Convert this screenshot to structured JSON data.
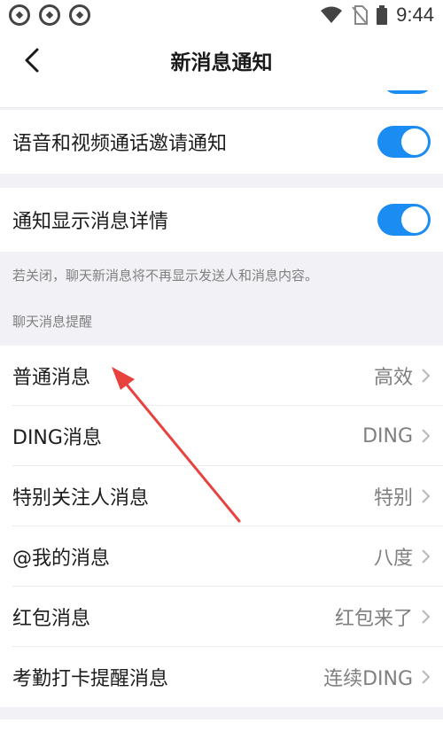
{
  "status_bar": {
    "time": "9:44",
    "left_icons": [
      "app-icon",
      "app-icon",
      "app-icon"
    ],
    "right_icons": [
      "wifi-icon",
      "no-sim-icon",
      "battery-icon"
    ]
  },
  "nav": {
    "title": "新消息通知",
    "back_icon": "chevron-left-icon"
  },
  "settings": {
    "voice_video_invite": {
      "label": "语音和视频通话邀请通知",
      "enabled": true
    },
    "show_details": {
      "label": "通知显示消息详情",
      "enabled": true
    },
    "show_details_hint": "若关闭，聊天新消息将不再显示发送人和消息内容。"
  },
  "section_header": "聊天消息提醒",
  "reminder_items": [
    {
      "label": "普通消息",
      "value": "高效"
    },
    {
      "label": "DING消息",
      "value": "DING"
    },
    {
      "label": "特别关注人消息",
      "value": "特别"
    },
    {
      "label": "@我的消息",
      "value": "八度"
    },
    {
      "label": "红包消息",
      "value": "红包来了"
    },
    {
      "label": "考勤打卡提醒消息",
      "value": "连续DING"
    }
  ],
  "colors": {
    "accent": "#1a8cf2",
    "annotation_arrow": "#e8423f",
    "background": "#f2f2f6"
  }
}
